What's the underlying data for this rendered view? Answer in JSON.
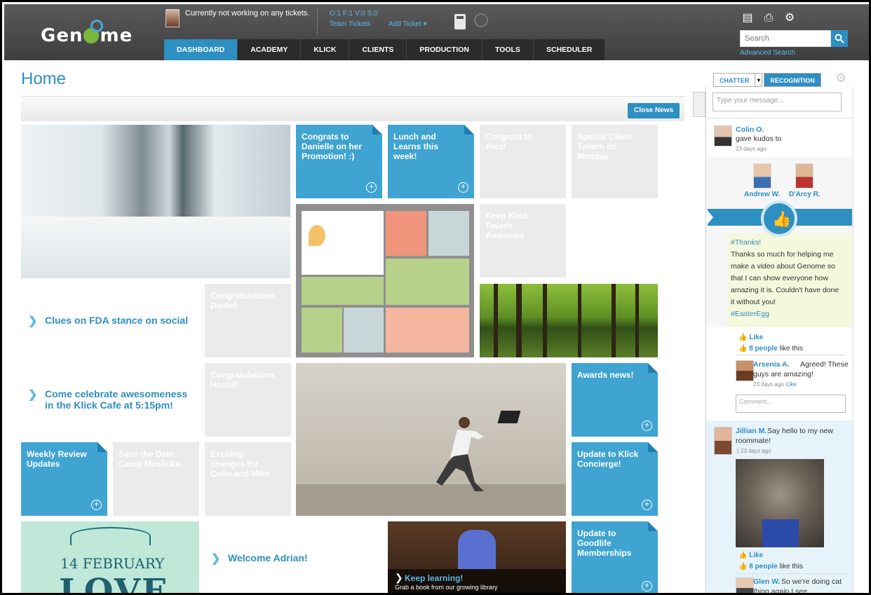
{
  "header": {
    "logo_text": "Genome",
    "user_status": "Currently not working on any tickets.",
    "ticket_counts": "O:1 F:1 V:0 S:0",
    "team_tickets": "Team Tickets",
    "add_ticket": "Add Ticket",
    "search_placeholder": "Search",
    "advanced_search": "Advanced Search",
    "nav": [
      {
        "label": "DASHBOARD",
        "active": true
      },
      {
        "label": "ACADEMY"
      },
      {
        "label": "KLICK"
      },
      {
        "label": "CLIENTS"
      },
      {
        "label": "PRODUCTION"
      },
      {
        "label": "TOOLS"
      },
      {
        "label": "SCHEDULER"
      }
    ],
    "icons": [
      "document-icon",
      "print-icon",
      "gear-icon"
    ]
  },
  "main": {
    "page_title": "Home",
    "close_news": "Close News",
    "tiles": {
      "congrats_danielle": "Congrats to Danielle on her Promotion! :)",
      "lunch_learns": "Lunch and Learns this week!",
      "congrats_alex": "Congrats to Alex!",
      "special_client": "Special Client Tavern on Monday",
      "keep_klick": "Keep Klick Tavern Awesome",
      "congrats_daniel": "Congratulations Daniel!",
      "congrats_hoshil": "Congratulations Hoshil!",
      "awards_news": "Awards news!",
      "weekly_review": "Weekly Review Updates",
      "save_date": "Save the Date: Camp Muskoka",
      "exciting_changes": "Exciting changes for Colin and Mike",
      "update_concierge": "Update to Klick Concierge!",
      "update_goodlife": "Update to Goodlife Memberships"
    },
    "links": {
      "fda": "Clues on FDA stance on social",
      "cafe": "Come celebrate awesomeness in the Klick Cafe at 5:15pm!",
      "welcome": "Welcome Adrian!"
    },
    "valentine": {
      "date": "14 FEBRUARY",
      "word": "LOVE"
    },
    "books": {
      "title": "Keep learning!",
      "subtitle": "Grab a book from our growing library"
    }
  },
  "chatter": {
    "tab_chatter": "CHATTER",
    "tab_recognition": "RECOGNITION",
    "message_placeholder": "Type your message...",
    "post1": {
      "author": "Colin O.",
      "action": "gave kudos to",
      "time": "23 days ago",
      "recipient1": "Andrew W.",
      "recipient2": "D'Arcy R.",
      "lines": [
        "#Thanks!",
        "Thanks so much for helping me",
        "make a video about Genome so",
        "that I can show everyone how",
        "amazing it is. Couldn't have done",
        "it without you!",
        "#EasterEgg"
      ],
      "like": "Like",
      "people_count": "8 people",
      "people_suffix": "like this"
    },
    "comment1": {
      "author": "Arsenia A.",
      "text_first": "Agreed! These",
      "text_second": "guys are amazing!",
      "time": "23 days ago",
      "like": "Like",
      "input_placeholder": "Comment..."
    },
    "post2": {
      "author": "Jillian M.",
      "text_first": "Say hello to my new",
      "text_second": "roommate!",
      "time": ":) 23 days ago",
      "like": "Like",
      "people_count": "8 people",
      "people_suffix": "like this"
    },
    "post3": {
      "author": "Glen W.",
      "text_first": "So we're doing cat",
      "text_second": "thing again I see..."
    }
  }
}
